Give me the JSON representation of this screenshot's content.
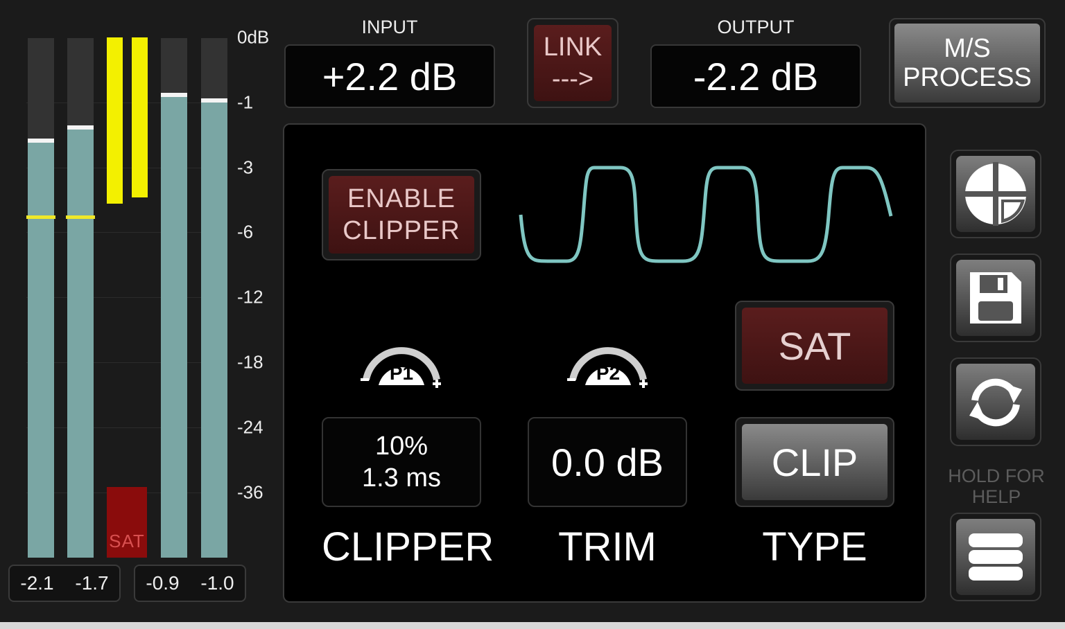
{
  "meters": {
    "scale": [
      "0dB",
      "-1",
      "-3",
      "-6",
      "-12",
      "-18",
      "-24",
      "-36"
    ],
    "sat_label": "SAT",
    "readouts_left": [
      "-2.1",
      "-1.7"
    ],
    "readouts_right": [
      "-0.9",
      "-1.0"
    ]
  },
  "input": {
    "caption": "INPUT",
    "value": "+2.2 dB"
  },
  "link": {
    "line1": "LINK",
    "line2": "--->"
  },
  "output": {
    "caption": "OUTPUT",
    "value": "-2.2 dB"
  },
  "ms_process": {
    "line1": "M/S",
    "line2": "PROCESS"
  },
  "enable_clipper": {
    "line1": "ENABLE",
    "line2": "CLIPPER"
  },
  "clipper": {
    "knob": "P1",
    "line1": "10%",
    "line2": "1.3 ms",
    "label": "CLIPPER"
  },
  "trim": {
    "knob": "P2",
    "value": "0.0 dB",
    "label": "TRIM"
  },
  "type": {
    "sat_button": "SAT",
    "clip_button": "CLIP",
    "label": "TYPE"
  },
  "help": {
    "line1": "HOLD FOR",
    "line2": "HELP"
  },
  "colors": {
    "meter_fill": "#7aa6a4",
    "peak_yellow": "#f3f000",
    "sat_red": "#8a0c0c",
    "wave": "#7fc6c2"
  }
}
